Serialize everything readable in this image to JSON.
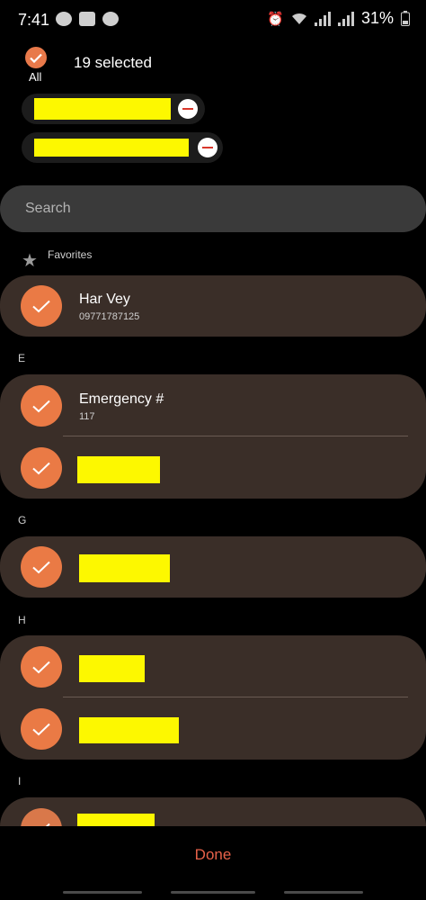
{
  "status_bar": {
    "time": "7:41",
    "battery": "31%"
  },
  "header": {
    "all_label": "All",
    "selected_label": "19 selected"
  },
  "search": {
    "placeholder": "Search"
  },
  "sections": {
    "favorites": "Favorites",
    "e": "E",
    "g": "G",
    "h": "H",
    "i": "I"
  },
  "contacts": {
    "har_vey": {
      "name": "Har Vey",
      "number": "09771787125"
    },
    "emergency": {
      "name": "Emergency #",
      "number": "117"
    }
  },
  "footer": {
    "done_label": "Done"
  },
  "colors": {
    "accent": "#ea7a45",
    "group_bg": "#3a2e28",
    "redaction": "#fdf800",
    "done": "#e8624a"
  }
}
